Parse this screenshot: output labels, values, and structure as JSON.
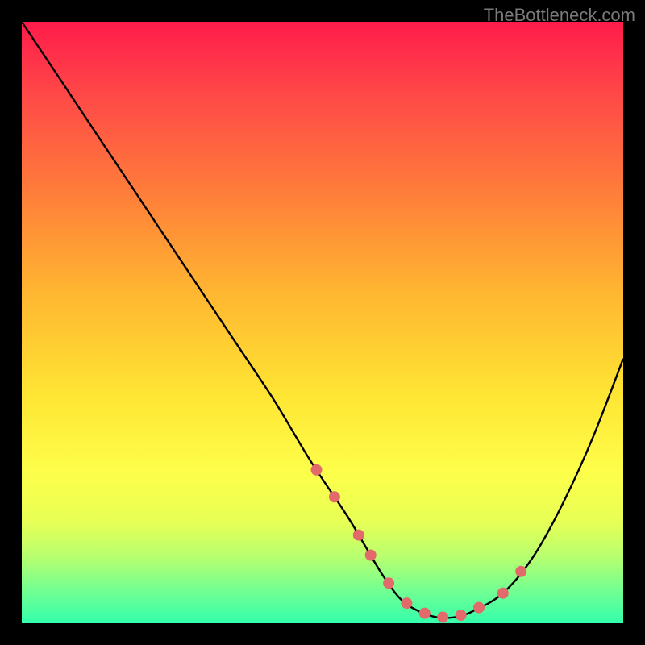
{
  "watermark": "TheBottleneck.com",
  "chart_data": {
    "type": "line",
    "title": "",
    "xlabel": "",
    "ylabel": "",
    "xlim": [
      0,
      100
    ],
    "ylim": [
      0,
      100
    ],
    "series": [
      {
        "name": "curve",
        "x": [
          0,
          6,
          12,
          18,
          24,
          30,
          36,
          42,
          48,
          54,
          57,
          60,
          63,
          66,
          69,
          72,
          75,
          80,
          85,
          90,
          95,
          100
        ],
        "y": [
          100,
          91,
          82,
          73,
          64,
          55,
          46,
          37,
          27,
          18,
          13,
          8,
          4,
          2,
          1,
          1,
          2,
          5,
          11,
          20,
          31,
          44
        ]
      }
    ],
    "optimal_markers_x": [
      49,
      52,
      56,
      58,
      61,
      64,
      67,
      70,
      73,
      76,
      80,
      83
    ],
    "marker_color": "#e26a6a"
  }
}
